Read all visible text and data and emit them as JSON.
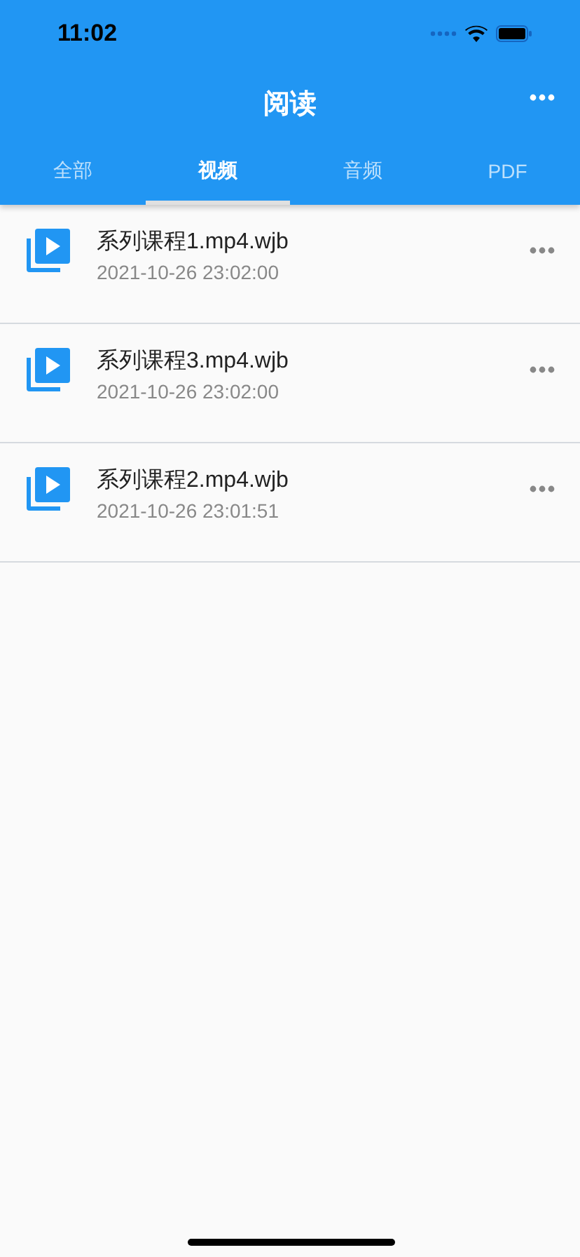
{
  "status_bar": {
    "time": "11:02"
  },
  "header": {
    "title": "阅读"
  },
  "tabs": [
    {
      "label": "全部",
      "selected": false
    },
    {
      "label": "视频",
      "selected": true
    },
    {
      "label": "音频",
      "selected": false
    },
    {
      "label": "PDF",
      "selected": false
    }
  ],
  "files": [
    {
      "name": "系列课程1.mp4.wjb",
      "date": "2021-10-26 23:02:00"
    },
    {
      "name": "系列课程3.mp4.wjb",
      "date": "2021-10-26 23:02:00"
    },
    {
      "name": "系列课程2.mp4.wjb",
      "date": "2021-10-26 23:01:51"
    }
  ]
}
